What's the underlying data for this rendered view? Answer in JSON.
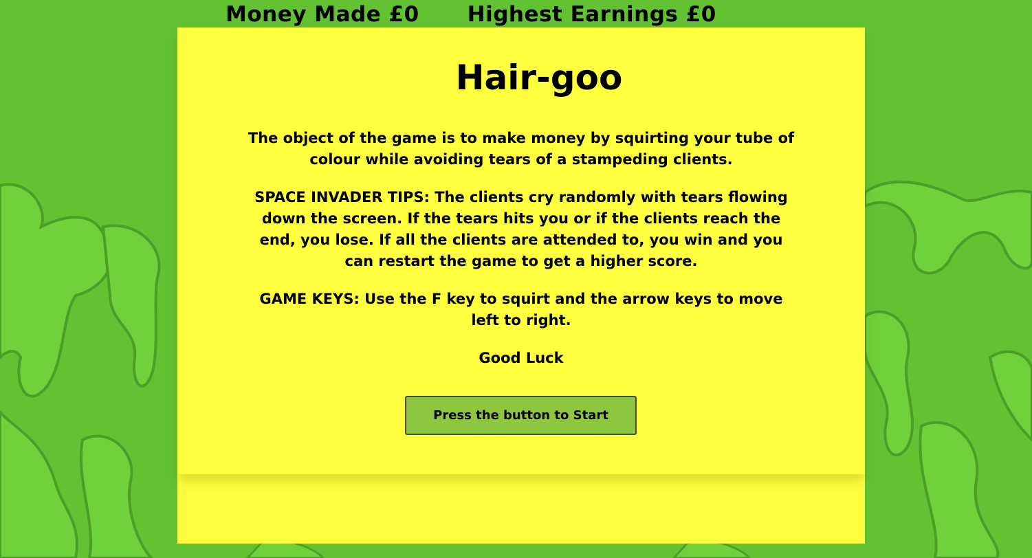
{
  "score": {
    "money_made_label": "Money Made £0",
    "highest_earnings_label": "Highest Earnings £0"
  },
  "intro": {
    "title": "Hair-goo",
    "paragraph1": "The object of the game is to make money by squirting your tube of colour while avoiding tears of a stampeding clients.",
    "paragraph2": "SPACE INVADER TIPS: The clients cry randomly with tears flowing down the screen. If the tears hits you or if the clients reach the end, you lose. If all the clients are attended to, you win and you can restart the game to get a higher score.",
    "paragraph3": "GAME KEYS: Use the F key to squirt and the arrow keys to move left to right.",
    "good_luck": "Good Luck",
    "start_button_label": "Press the button to Start"
  },
  "colors": {
    "background": "#5fbf2f",
    "panel": "#ffff3f",
    "button": "#8dc63f"
  }
}
